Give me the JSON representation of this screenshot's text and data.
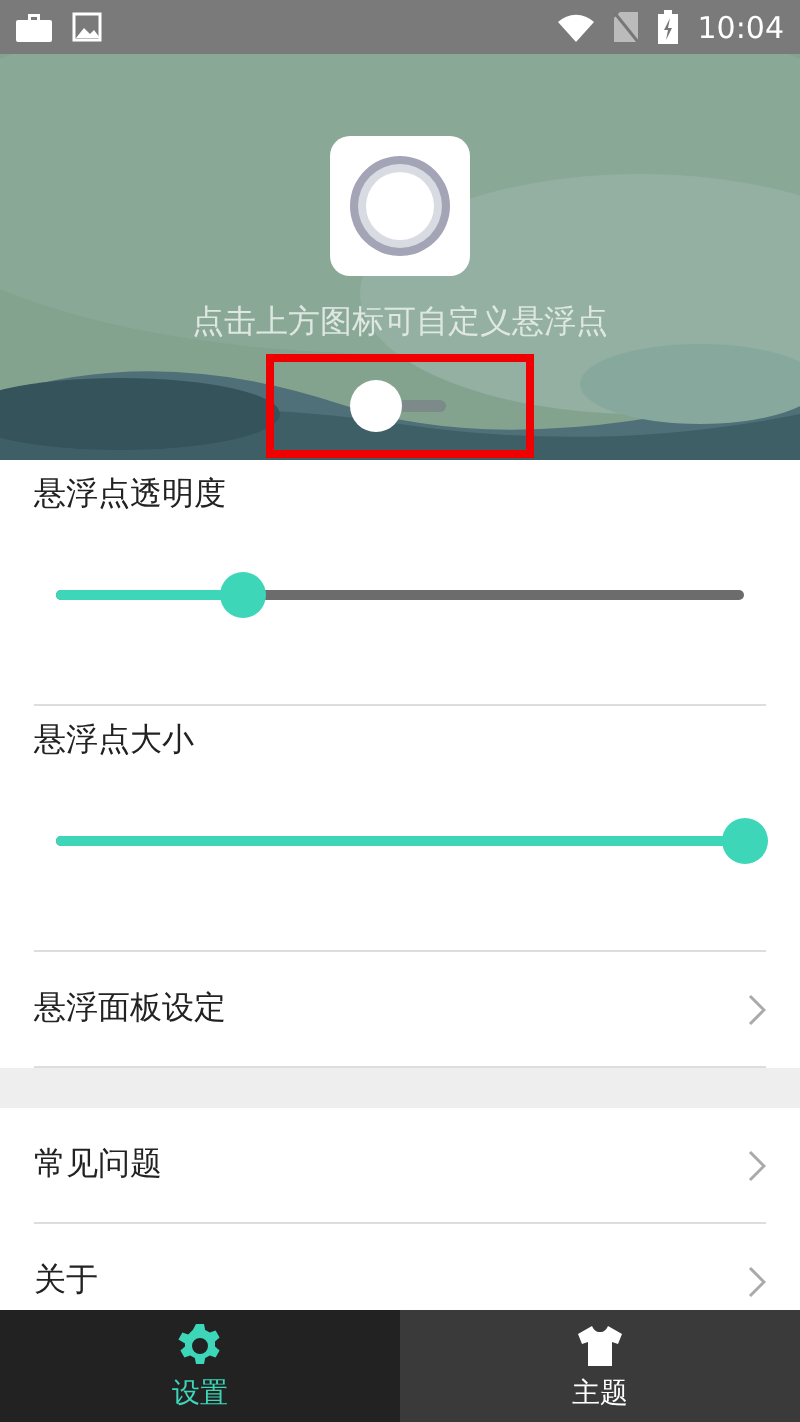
{
  "status_bar": {
    "time": "10:04"
  },
  "header": {
    "hint": "点击上方图标可自定义悬浮点",
    "toggle": {
      "on": false
    },
    "highlighted": true
  },
  "sliders": [
    {
      "label": "悬浮点透明度",
      "level": 0.27
    },
    {
      "label": "悬浮点大小",
      "level": 1.0
    }
  ],
  "menu_groups": [
    [
      {
        "label": "悬浮面板设定"
      }
    ],
    [
      {
        "label": "常见问题"
      },
      {
        "label": "关于"
      }
    ]
  ],
  "bottom_nav": [
    {
      "label": "设置",
      "kind": "gear",
      "selected": true
    },
    {
      "label": "主题",
      "kind": "shirt",
      "selected": false
    }
  ]
}
